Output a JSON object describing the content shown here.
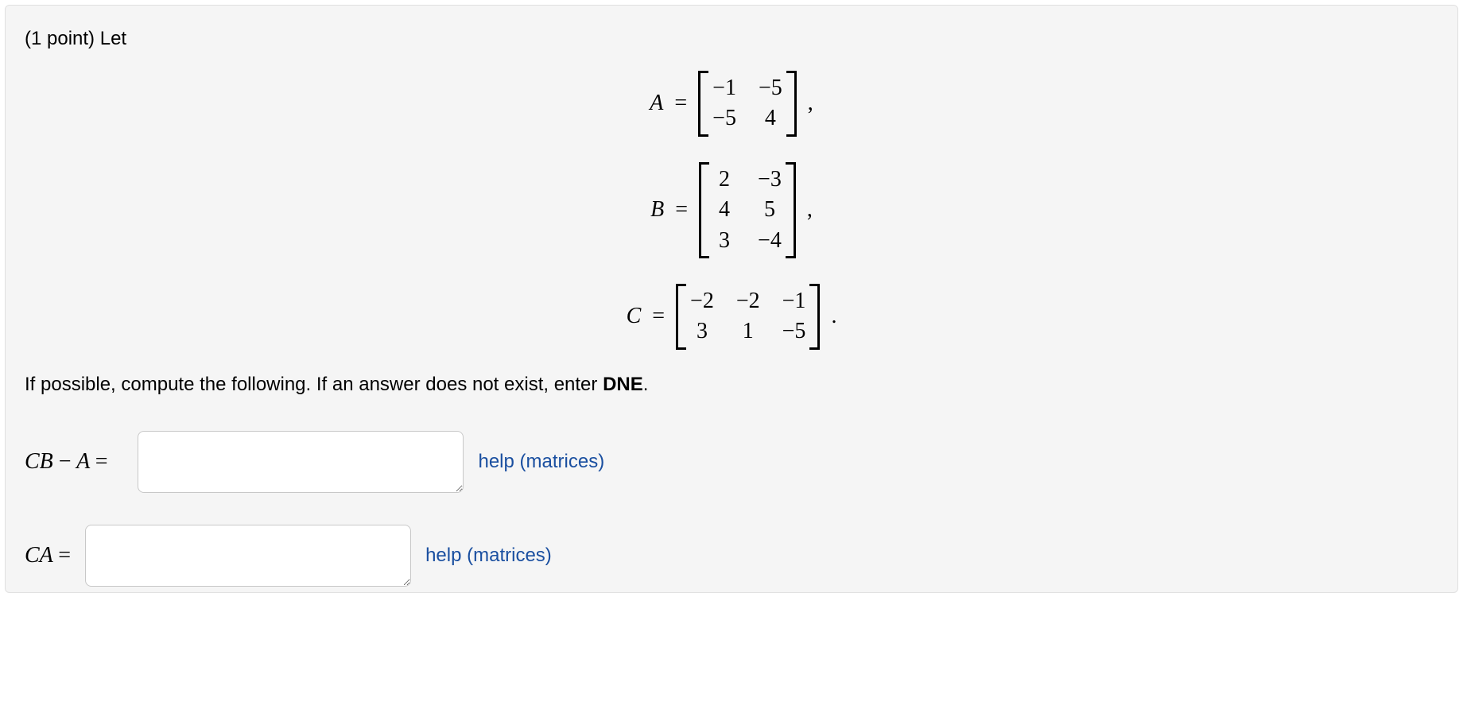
{
  "points_label": "(1 point)",
  "let_label": "Let",
  "matrices": {
    "A": {
      "label": "A",
      "cells": [
        "−1",
        "−5",
        "−5",
        "4"
      ],
      "trail": ","
    },
    "B": {
      "label": "B",
      "cells": [
        "2",
        "−3",
        "4",
        "5",
        "3",
        "−4"
      ],
      "trail": ","
    },
    "C": {
      "label": "C",
      "cells": [
        "−2",
        "−2",
        "−1",
        "3",
        "1",
        "−5"
      ],
      "trail": "."
    }
  },
  "eq": "=",
  "instruction_prefix": "If possible, compute the following. If an answer does not exist, enter ",
  "instruction_bold": "DNE",
  "instruction_suffix": ".",
  "answers": {
    "cb_minus_a": {
      "label": "CB − A =",
      "value": "",
      "help": "help (matrices)"
    },
    "ca": {
      "label": "CA =",
      "value": "",
      "help": "help (matrices)"
    }
  }
}
